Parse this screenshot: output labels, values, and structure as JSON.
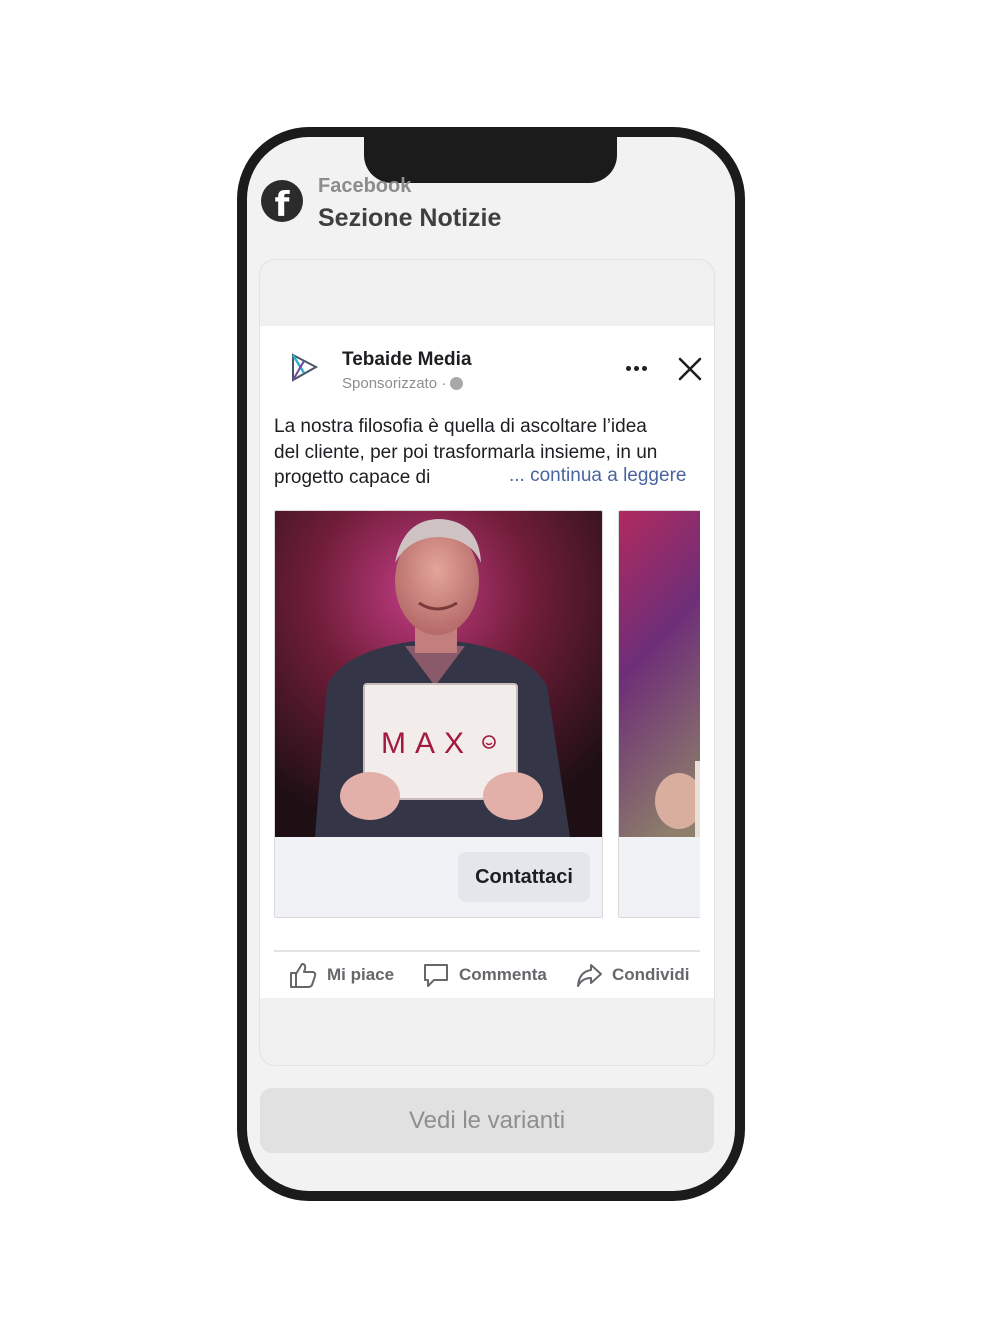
{
  "header": {
    "app_name": "Facebook",
    "section_title": "Sezione Notizie"
  },
  "post": {
    "page_name": "Tebaide Media",
    "sponsored_label": "Sponsorizzato ·",
    "caption_lines": [
      "La nostra filosofia è quella di ascoltare l’idea",
      "del cliente, per poi trasformarla insieme, in un",
      "progetto capace di"
    ],
    "see_more": "... continua a leggere",
    "carousel": [
      {
        "sign_text": "MAX",
        "cta_label": "Contattaci"
      },
      {
        "sign_text": "",
        "cta_label": ""
      }
    ],
    "actions": {
      "like": "Mi piace",
      "comment": "Commenta",
      "share": "Condividi"
    }
  },
  "footer": {
    "variants_button": "Vedi le varianti"
  },
  "colors": {
    "link": "#4a64a0",
    "phone_frame": "#1b1b1b",
    "screen_bg": "#f2f2f2"
  },
  "icons": [
    "facebook-logo-icon",
    "tebaide-media-logo-icon",
    "globe-icon",
    "more-icon",
    "close-icon",
    "thumbs-up-icon",
    "comment-icon",
    "share-icon",
    "smiley-icon"
  ]
}
